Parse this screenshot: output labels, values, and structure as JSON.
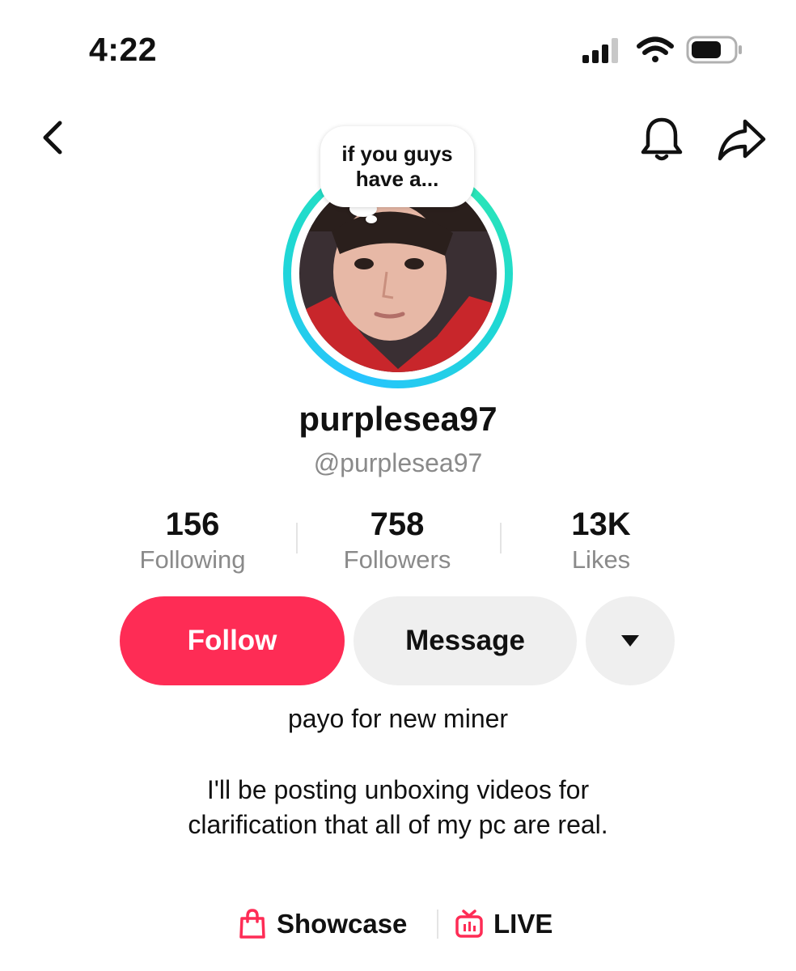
{
  "status_bar": {
    "time": "4:22",
    "icons": [
      "signal-icon",
      "wifi-icon",
      "battery-icon"
    ]
  },
  "nav": {
    "icons": [
      "back-chevron-icon",
      "bell-icon",
      "share-arrow-icon"
    ]
  },
  "profile": {
    "note_bubble": "if you guys have a...",
    "display_name": "purplesea97",
    "username": "@purplesea97"
  },
  "stats": [
    {
      "count": "156",
      "label": "Following"
    },
    {
      "count": "758",
      "label": "Followers"
    },
    {
      "count": "13K",
      "label": "Likes"
    }
  ],
  "actions": {
    "follow_label": "Follow",
    "message_label": "Message",
    "more_icon": "caret-down-icon"
  },
  "bio": {
    "title": "payo for new miner",
    "text": "I'll be posting unboxing videos for clarification that all of my pc are real."
  },
  "links": [
    {
      "label": "Showcase",
      "icon": "shopping-bag-icon"
    },
    {
      "label": "LIVE",
      "icon": "live-tv-icon"
    }
  ],
  "colors": {
    "accent": "#fe2c55",
    "ring_start": "#27c4ff",
    "ring_end": "#2ee8b0",
    "muted_text": "#8a8a8a",
    "button_gray": "#efefef"
  }
}
